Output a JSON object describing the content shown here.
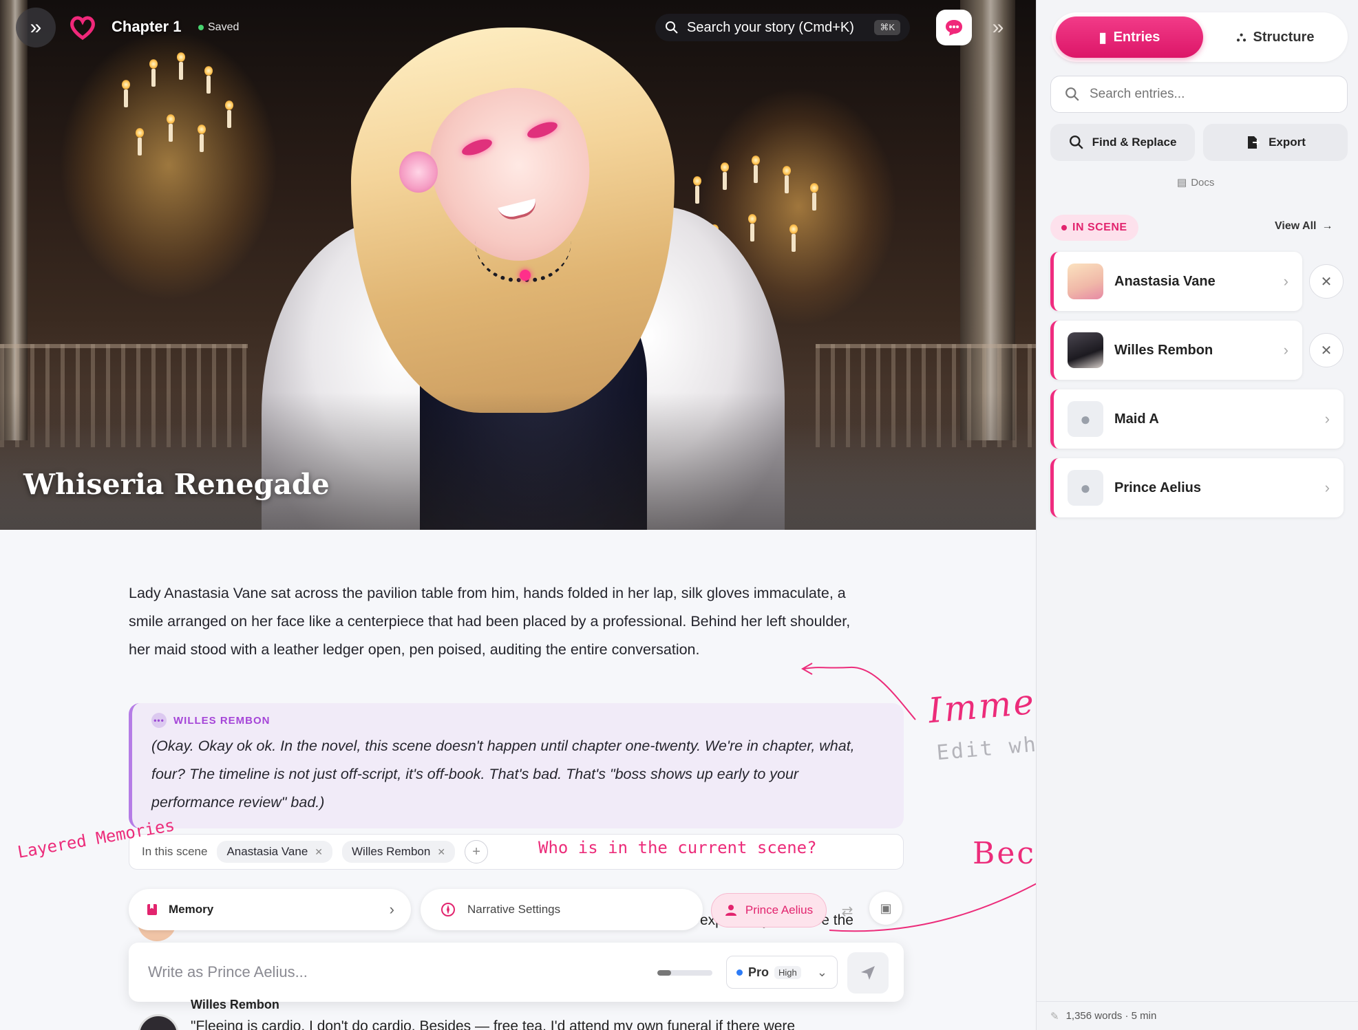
{
  "header": {
    "chapter": "Chapter 1",
    "save_status": "Saved",
    "search_placeholder": "Search your story (Cmd+K)",
    "search_shortcut": "⌘K"
  },
  "hero": {
    "title": "Whiseria Renegade"
  },
  "story": {
    "paragraph": "Lady Anastasia Vane sat across the pavilion table from him, hands folded in her lap, silk gloves immaculate, a smile arranged on her face like a centerpiece that had been placed by a professional. Behind her left shoulder, her maid stood with a leather ledger open, pen poised, auditing the entire conversation.",
    "thought": {
      "speaker": "WILLES REMBON",
      "text": "(Okay. Okay ok ok. In the novel, this scene doesn't happen until chapter one-twenty. We're in chapter, what, four? The timeline is not just off-script, it's off-book. That's bad. That's \"boss shows up early to your performance review\" bad.)"
    },
    "scene_bar": {
      "label": "In this scene",
      "chips": [
        "Anastasia Vane",
        "Willes Rembon"
      ]
    },
    "behind_text": "-expected you to flee the",
    "next_message": {
      "name": "Willes Rembon",
      "text": "\"Fleeing is cardio. I don't do cardio. Besides — free tea. I'd attend my own funeral if there were"
    }
  },
  "toolbar": {
    "memory_label": "Memory",
    "narrative_label": "Narrative Settings",
    "persona_label": "Prince Aelius"
  },
  "composer": {
    "placeholder": "Write as Prince Aelius...",
    "model": "Pro",
    "tier": "High",
    "slider_level": 0.25
  },
  "annotations": {
    "roleplay": "Immersive Roleplay",
    "edit": "Edit when you need it",
    "memories": "Layered Memories",
    "who": "Who is in the current scene?",
    "mc": "Become the Mc"
  },
  "sidebar": {
    "tabs": [
      {
        "label": "Entries",
        "icon": "book-icon"
      },
      {
        "label": "Structure",
        "icon": "tree-icon"
      }
    ],
    "search_placeholder": "Search entries...",
    "actions": {
      "find_replace": "Find & Replace",
      "export": "Export"
    },
    "docs_label": "Docs",
    "in_scene_label": "IN SCENE",
    "view_all_label": "View All",
    "entries": [
      {
        "name": "Anastasia Vane",
        "removable": true
      },
      {
        "name": "Willes Rembon",
        "removable": true
      },
      {
        "name": "Maid A",
        "removable": false
      },
      {
        "name": "Prince Aelius",
        "removable": false
      }
    ],
    "footer": "1,356 words · 5 min"
  },
  "colors": {
    "accent": "#ec2c7a",
    "thought_accent": "#a545d8",
    "save_dot": "#47d36f"
  }
}
